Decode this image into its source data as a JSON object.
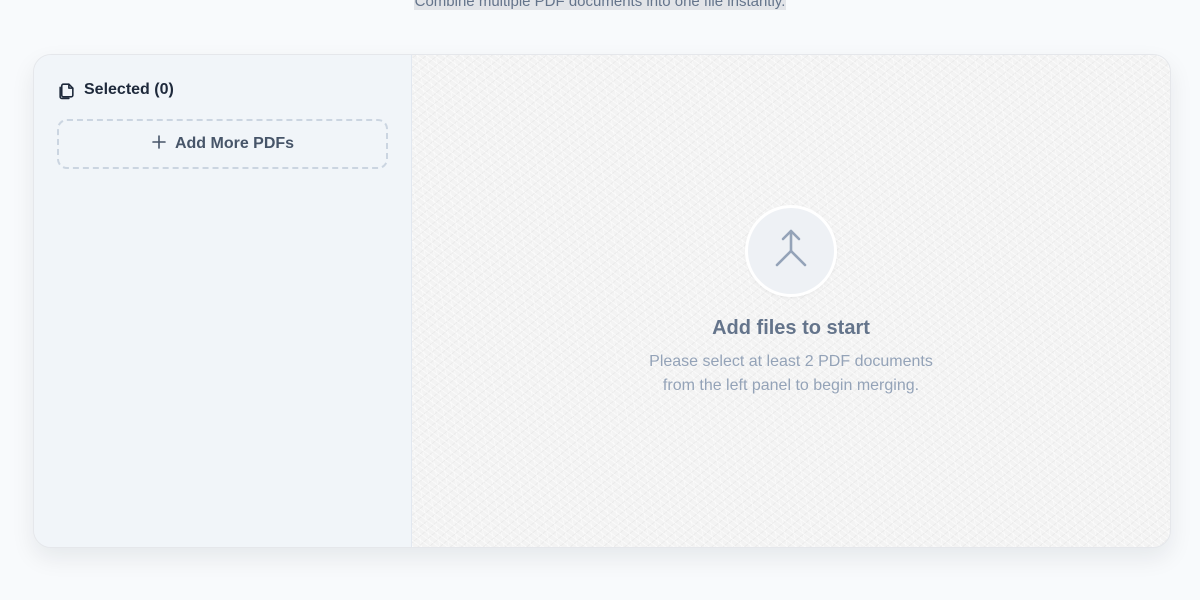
{
  "header": {
    "subtitle": "Combine multiple PDF documents into one file instantly."
  },
  "left_panel": {
    "title": "Selected (0)",
    "add_button_label": "Add More PDFs",
    "icons": {
      "header": "copy-files-icon",
      "add": "plus-icon"
    }
  },
  "empty_state": {
    "icon": "merge-arrow-icon",
    "title": "Add files to start",
    "description": "Please select at least 2 PDF documents from the left panel to begin merging."
  },
  "colors": {
    "background": "#f8fafc",
    "panel_bg": "#f1f5f9",
    "title_text": "#1e293b",
    "muted_text": "#64748b",
    "light_text": "#94a3b8",
    "dashed_border": "#cbd5e1"
  }
}
